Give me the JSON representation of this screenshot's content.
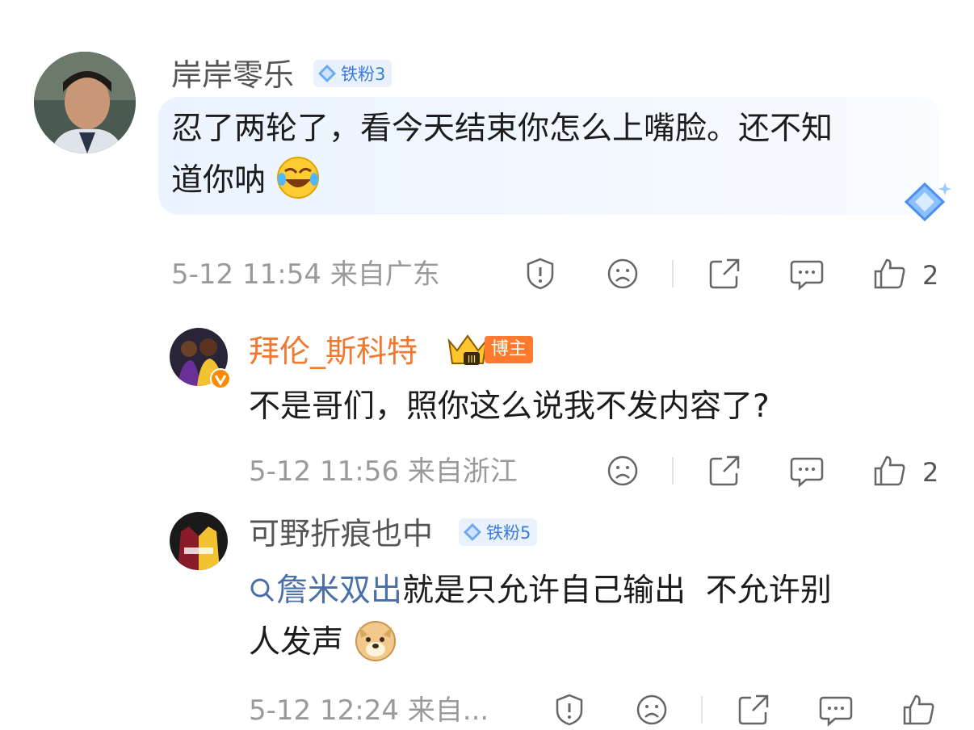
{
  "comments": [
    {
      "username": "岸岸零乐",
      "badge": "铁粉3",
      "text_line1": "忍了两轮了，看今天结束你怎么上嘴脸。还不知",
      "text_line2": "道你呐",
      "meta": "5-12 11:54 来自广东",
      "likes": "2"
    },
    {
      "username": "拜伦_斯科特",
      "badge": "博主",
      "text": "不是哥们，照你这么说我不发内容了?",
      "meta": "5-12 11:56 来自浙江",
      "likes": "2"
    },
    {
      "username": "可野折痕也中",
      "badge": "铁粉5",
      "link": "詹米双出",
      "text_line1": "就是只允许自己输出  不允许别",
      "text_line2": "人发声",
      "meta": "5-12 12:24 来自..."
    }
  ],
  "colors": {
    "accent": "#ff7a2e",
    "badge_blue": "#3a7bde",
    "link": "#4a6fa8",
    "meta": "#9a9a9a"
  },
  "icons": [
    "report-icon",
    "dislike-icon",
    "share-icon",
    "comment-icon",
    "like-icon",
    "search-icon",
    "crown-icon",
    "verified-icon",
    "diamond-icon"
  ]
}
